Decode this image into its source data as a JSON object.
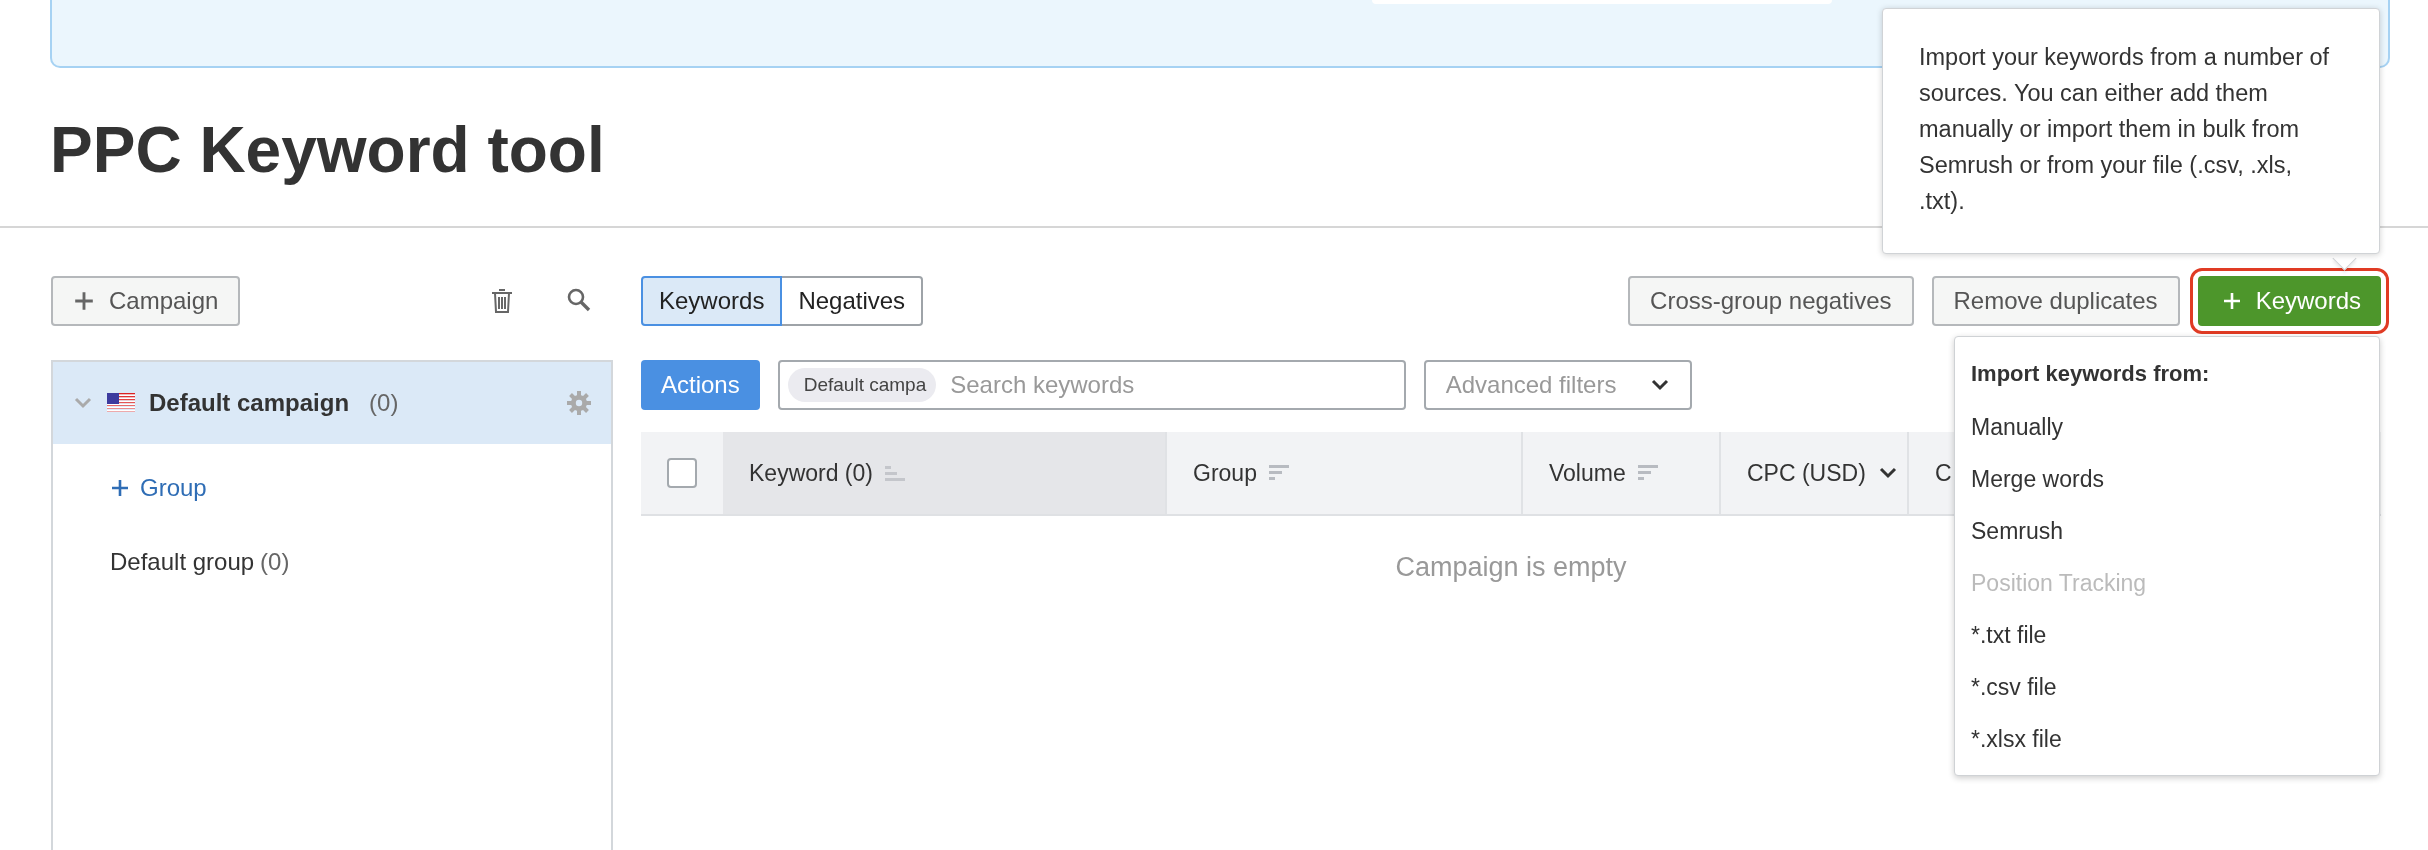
{
  "page": {
    "title": "PPC Keyword tool"
  },
  "sidebar": {
    "add_button": "Campaign",
    "campaigns": [
      {
        "name": "Default campaign",
        "count": "(0)",
        "selected": true,
        "expanded": true,
        "add_group": "Group",
        "groups": [
          {
            "name": "Default group",
            "count": "(0)"
          }
        ]
      }
    ]
  },
  "tabs": [
    {
      "label": "Keywords",
      "selected": true
    },
    {
      "label": "Negatives",
      "selected": false
    }
  ],
  "toolbar_buttons": [
    {
      "label": "Cross-group negatives",
      "kind": "secondary",
      "highlighted": false
    },
    {
      "label": "Remove duplicates",
      "kind": "secondary",
      "highlighted": false
    },
    {
      "label": "Keywords",
      "kind": "primary",
      "highlighted": true
    }
  ],
  "actions_button": "Actions",
  "search": {
    "chip": "Default campa",
    "placeholder": "Search keywords"
  },
  "filters": {
    "label": "Advanced filters"
  },
  "table": {
    "select_all_checked": false,
    "columns": [
      {
        "label": "Keyword (0)",
        "kind": "sort",
        "selected": true
      },
      {
        "label": "Group",
        "kind": "sort",
        "selected": false
      },
      {
        "label": "Volume",
        "kind": "sort",
        "selected": false
      },
      {
        "label": "CPC (USD)",
        "kind": "dropdown",
        "selected": false
      },
      {
        "label": "C",
        "kind": "plain",
        "selected": false
      }
    ],
    "empty_message": "Campaign is empty"
  },
  "tooltip": {
    "text": "Import your keywords from a number of sources. You can either add them manually or import them in bulk from Semrush or from your file (.csv, .xls, .txt)."
  },
  "import_menu": {
    "heading": "Import keywords from:",
    "items": [
      {
        "label": "Manually",
        "disabled": false
      },
      {
        "label": "Merge words",
        "disabled": false
      },
      {
        "label": "Semrush",
        "disabled": false
      },
      {
        "label": "Position Tracking",
        "disabled": true
      },
      {
        "label": "*.txt file",
        "disabled": false
      },
      {
        "label": "*.csv file",
        "disabled": false
      },
      {
        "label": "*.xlsx file",
        "disabled": false
      }
    ]
  }
}
